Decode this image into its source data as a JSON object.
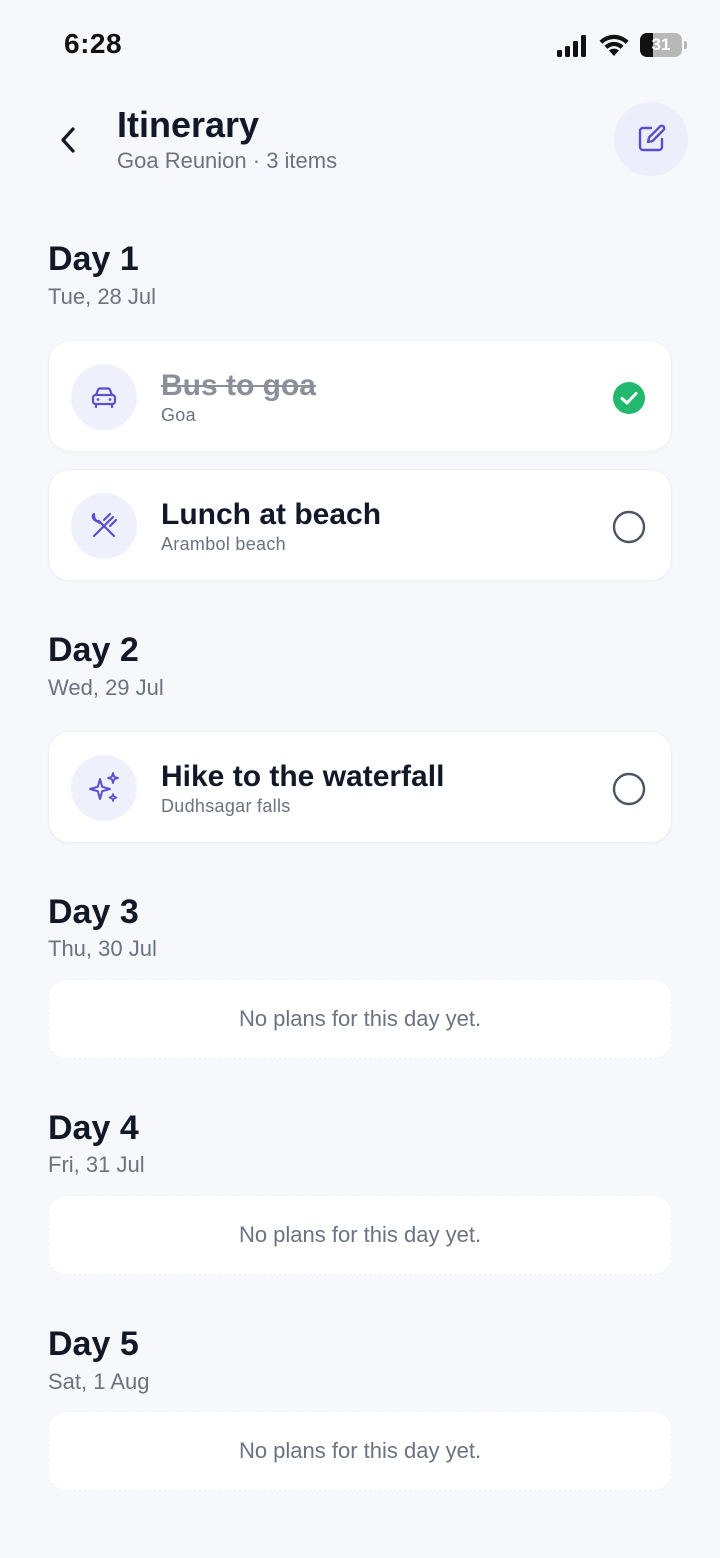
{
  "status_bar": {
    "time": "6:28",
    "battery_level": "31",
    "battery_fraction": 0.31
  },
  "header": {
    "title": "Itinerary",
    "subtitle": "Goa Reunion · 3 items"
  },
  "colors": {
    "accent": "#5b4fcf",
    "success": "#22b86e",
    "icon_bg": "#eef0fb"
  },
  "days": [
    {
      "title": "Day 1",
      "date": "Tue, 28 Jul",
      "items": [
        {
          "icon": "car-icon",
          "title": "Bus to goa",
          "location": "Goa",
          "completed": true
        },
        {
          "icon": "utensils-icon",
          "title": "Lunch at beach",
          "location": "Arambol beach",
          "completed": false
        }
      ]
    },
    {
      "title": "Day 2",
      "date": "Wed, 29 Jul",
      "items": [
        {
          "icon": "sparkles-icon",
          "title": "Hike to the waterfall",
          "location": "Dudhsagar falls",
          "completed": false
        }
      ]
    },
    {
      "title": "Day 3",
      "date": "Thu, 30 Jul",
      "empty_text": "No plans for this day yet."
    },
    {
      "title": "Day 4",
      "date": "Fri, 31 Jul",
      "empty_text": "No plans for this day yet."
    },
    {
      "title": "Day 5",
      "date": "Sat, 1 Aug",
      "empty_text": "No plans for this day yet."
    }
  ]
}
